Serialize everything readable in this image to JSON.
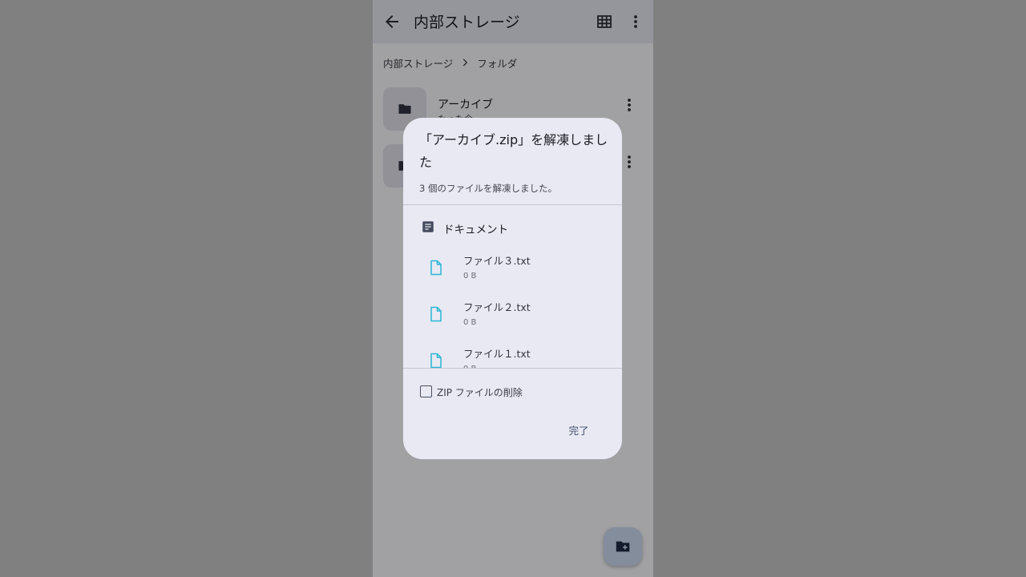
{
  "appbar": {
    "title": "内部ストレージ",
    "back_icon": "arrow-back-icon",
    "grid_icon": "grid-view-icon",
    "more_icon": "more-vert-icon"
  },
  "breadcrumb": {
    "items": [
      "内部ストレージ",
      "フォルダ"
    ]
  },
  "folders": [
    {
      "name": "アーカイブ",
      "sub": "たった今"
    },
    {
      "name": "",
      "sub": ""
    }
  ],
  "dialog": {
    "title": "「アーカイブ.zip」を解凍しました",
    "message": "3 個のファイルを解凍しました。",
    "group_label": "ドキュメント",
    "files": [
      {
        "name": "ファイル３.txt",
        "size": "0 B"
      },
      {
        "name": "ファイル２.txt",
        "size": "0 B"
      },
      {
        "name": "ファイル１.txt",
        "size": "0 B"
      }
    ],
    "delete_zip_label": "ZIP ファイルの削除",
    "delete_zip_checked": false,
    "done_label": "完了"
  },
  "colors": {
    "accent_file_icon": "#29b6d6",
    "dialog_bg": "#e8e9f2",
    "scrim": "#808080"
  }
}
